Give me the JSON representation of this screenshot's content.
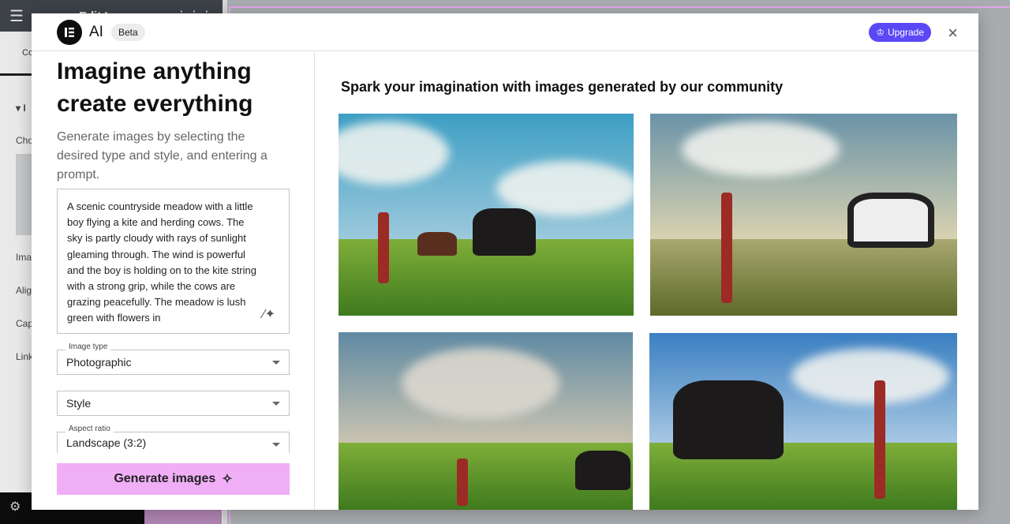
{
  "editor": {
    "title": "Edit Image",
    "tab": "Co",
    "section": "I",
    "labels": [
      "Cho",
      "Ima",
      "Alig",
      "Cap",
      "Link"
    ]
  },
  "modal": {
    "brand": "AI",
    "badge": "Beta",
    "upgrade_label": "Upgrade",
    "close_label": "×",
    "heading": "Imagine anything create everything",
    "subheading": "Generate images by selecting the desired type and style, and entering a prompt.",
    "prompt": "A scenic countryside meadow with a little boy flying a kite and herding cows. The sky is partly cloudy with rays of sunlight gleaming through. The wind is powerful and the boy is holding on to the kite string with a strong grip, while the cows are grazing peacefully. The meadow is lush green with flowers in",
    "image_type": {
      "label": "Image type",
      "value": "Photographic"
    },
    "style": {
      "placeholder": "Style"
    },
    "aspect_ratio": {
      "label": "Aspect ratio",
      "value": "Landscape (3:2)"
    },
    "generate_label": "Generate images",
    "gallery_title": "Spark your imagination with images generated by our community"
  },
  "colors": {
    "upgrade": "#5b48f5",
    "generate": "#f0aef7",
    "canvas_outline": "#e3a6ec"
  }
}
